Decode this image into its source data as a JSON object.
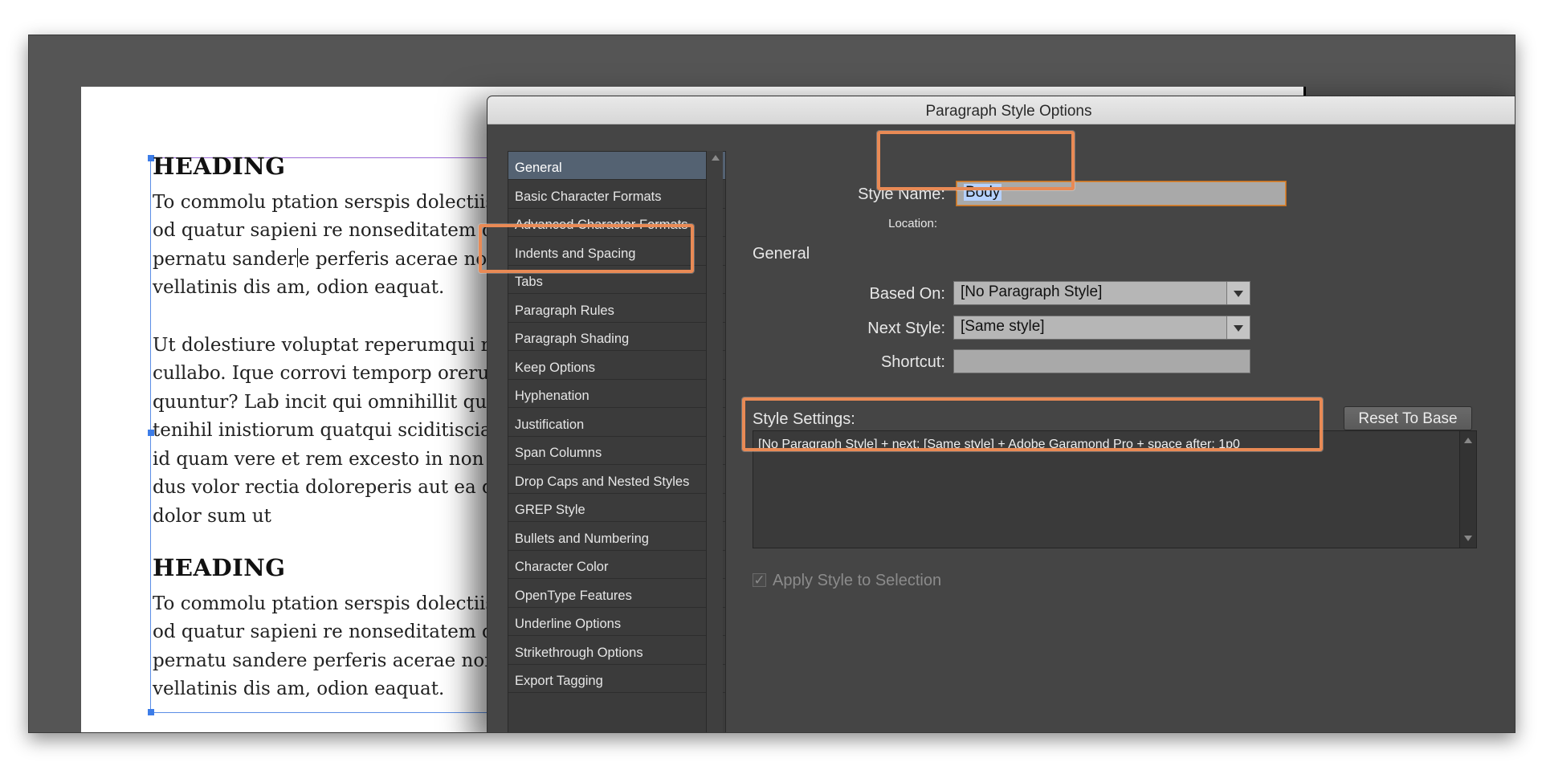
{
  "document": {
    "heading_1": "HEADING",
    "para_1": [
      "To commolu ptation serspis dolectiis",
      "od quatur sapieni re nonseditatem q",
      "pernatu sandere perferis acerae none",
      "vellatinis dis am, odion eaquat."
    ],
    "para_1_line3_a": "pernatu sander",
    "para_1_line3_b": "e perferis acerae none",
    "para_2": [
      "Ut dolestiure voluptat reperumqui re",
      "cullabo. Ique corrovi temporp orerum",
      "quuntur? Lab incit qui omnihillit qu",
      "tenihil inistiorum quatqui sciditiscia",
      "id quam vere et rem excesto in non p",
      "dus volor rectia doloreperis aut ea di",
      "dolor sum ut"
    ],
    "heading_2": "HEADING",
    "para_3": [
      "To commolu ptation serspis dolectiis",
      "od quatur sapieni re nonseditatem q",
      "pernatu sandere perferis acerae none",
      "vellatinis dis am, odion eaquat."
    ]
  },
  "dialog": {
    "title": "Paragraph Style Options",
    "categories": [
      {
        "label": "General",
        "selected": true
      },
      {
        "label": "Basic Character Formats"
      },
      {
        "label": "Advanced Character Formats"
      },
      {
        "label": "Indents and Spacing"
      },
      {
        "label": "Tabs"
      },
      {
        "label": "Paragraph Rules"
      },
      {
        "label": "Paragraph Shading"
      },
      {
        "label": "Keep Options"
      },
      {
        "label": "Hyphenation"
      },
      {
        "label": "Justification"
      },
      {
        "label": "Span Columns"
      },
      {
        "label": "Drop Caps and Nested Styles"
      },
      {
        "label": "GREP Style"
      },
      {
        "label": "Bullets and Numbering"
      },
      {
        "label": "Character Color"
      },
      {
        "label": "OpenType Features"
      },
      {
        "label": "Underline Options"
      },
      {
        "label": "Strikethrough Options"
      },
      {
        "label": "Export Tagging"
      }
    ],
    "style_name_label": "Style Name:",
    "style_name_value": "Body",
    "location_label": "Location:",
    "section_title": "General",
    "based_on_label": "Based On:",
    "based_on_value": "[No Paragraph Style]",
    "next_style_label": "Next Style:",
    "next_style_value": "[Same style]",
    "shortcut_label": "Shortcut:",
    "shortcut_value": "",
    "style_settings_label": "Style Settings:",
    "reset_button": "Reset To Base",
    "style_settings_text": "[No Paragraph Style] + next: [Same style] + Adobe Garamond Pro + space after: 1p0",
    "apply_checkbox_label": "Apply Style to Selection",
    "apply_checked": true
  },
  "colors": {
    "highlight": "#e98a55",
    "selected_category": "#546272",
    "frame_guide": "#5b8ee6"
  }
}
